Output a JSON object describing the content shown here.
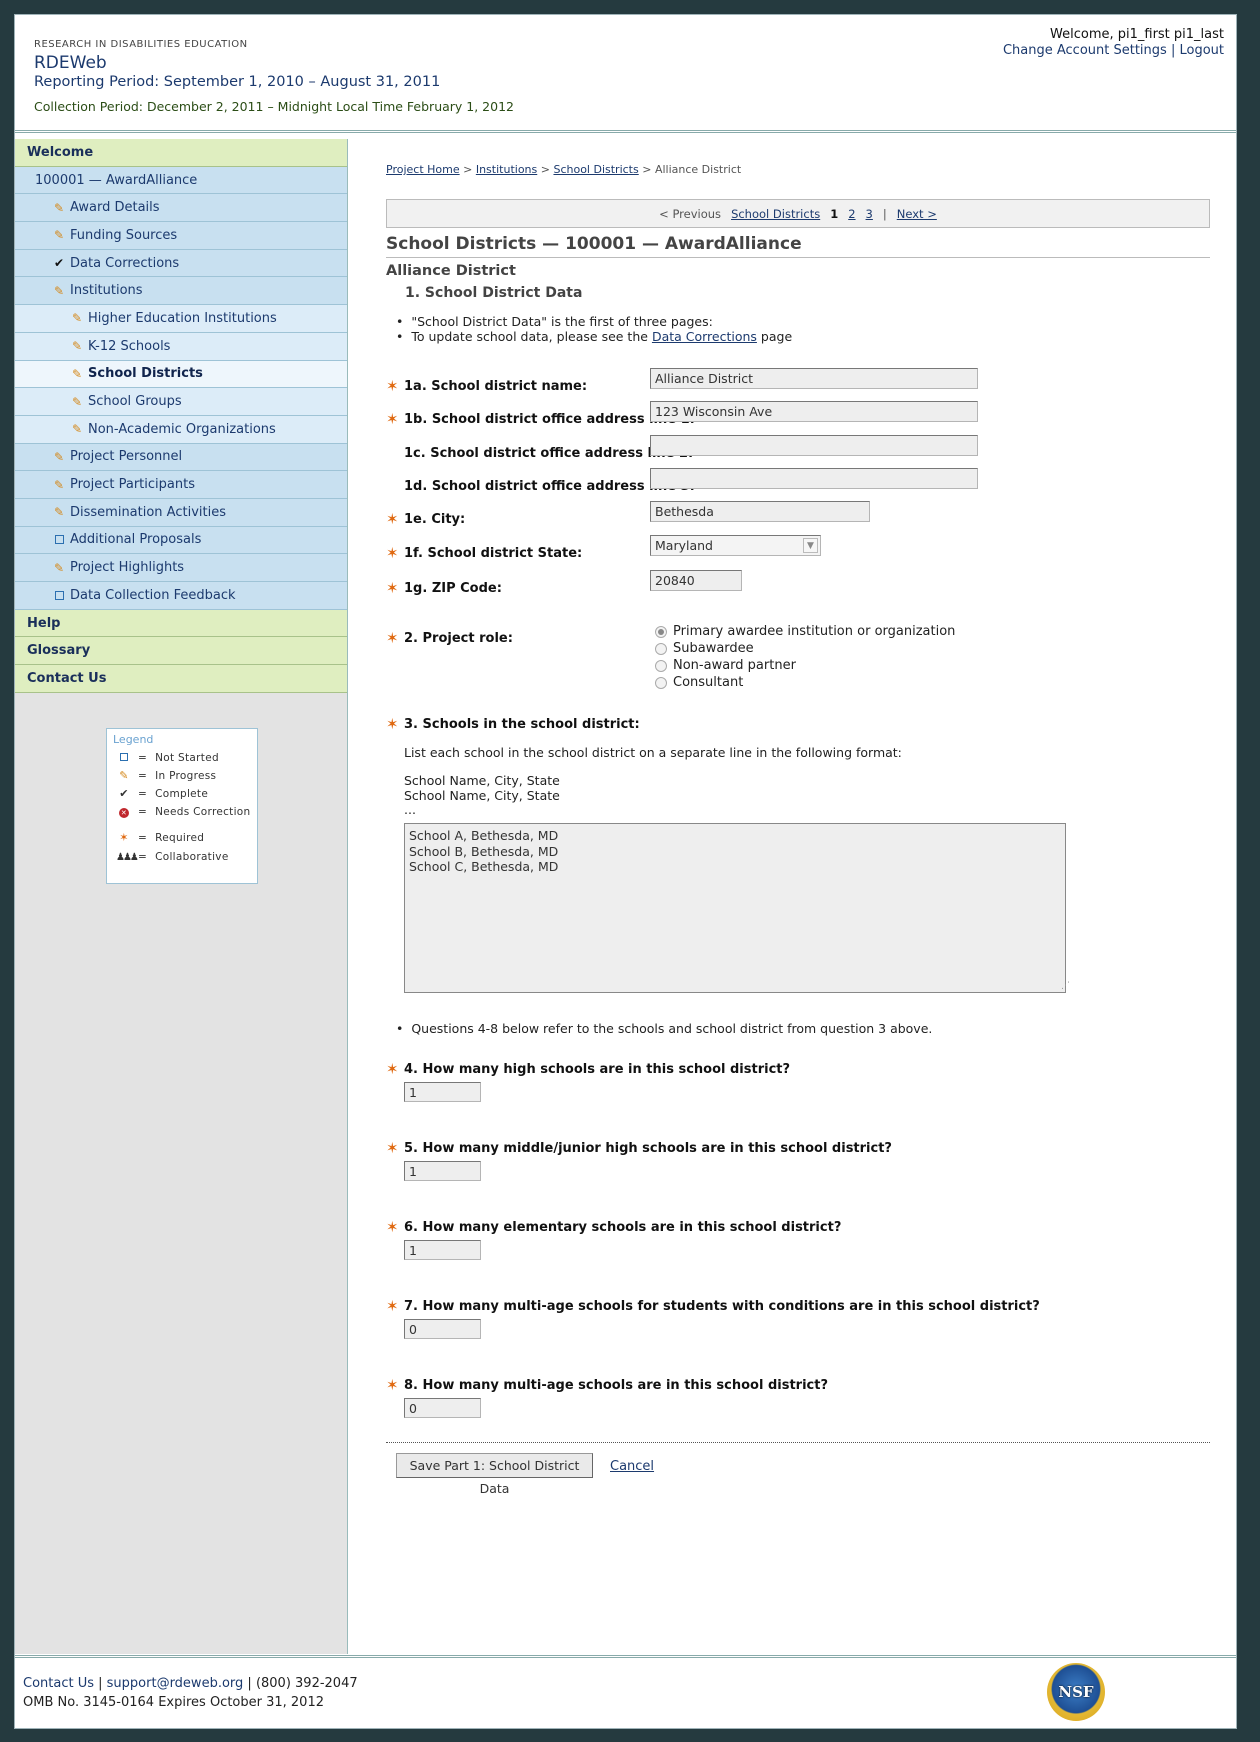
{
  "header": {
    "org": "RESEARCH IN DISABILITIES EDUCATION",
    "app": "RDEWeb",
    "reporting_period": "Reporting Period: September 1, 2010 – August 31, 2011",
    "collection_period": "Collection Period: December 2, 2011 – Midnight Local Time February 1, 2012",
    "welcome": "Welcome, pi1_first pi1_last",
    "change_settings": "Change Account Settings",
    "separator": "|",
    "logout": "Logout"
  },
  "sidebar": {
    "welcome": "Welcome",
    "award": "100001 — AwardAlliance",
    "items": [
      {
        "label": "Award Details",
        "icon": "pencil-icon"
      },
      {
        "label": "Funding Sources",
        "icon": "pencil-icon"
      },
      {
        "label": "Data Corrections",
        "icon": "check-icon"
      },
      {
        "label": "Institutions",
        "icon": "pencil-icon"
      }
    ],
    "sub_items": [
      {
        "label": "Higher Education Institutions",
        "icon": "pencil-icon"
      },
      {
        "label": "K-12 Schools",
        "icon": "pencil-icon"
      },
      {
        "label": "School Districts",
        "icon": "pencil-icon",
        "active": true
      },
      {
        "label": "School Groups",
        "icon": "pencil-icon"
      },
      {
        "label": "Non-Academic Organizations",
        "icon": "pencil-icon"
      }
    ],
    "items2": [
      {
        "label": "Project Personnel",
        "icon": "pencil-icon"
      },
      {
        "label": "Project Participants",
        "icon": "pencil-icon"
      },
      {
        "label": "Dissemination Activities",
        "icon": "pencil-icon"
      },
      {
        "label": "Additional Proposals",
        "icon": "box-icon"
      },
      {
        "label": "Project Highlights",
        "icon": "pencil-icon"
      },
      {
        "label": "Data Collection Feedback",
        "icon": "box-icon"
      }
    ],
    "help": "Help",
    "glossary": "Glossary",
    "contact": "Contact Us"
  },
  "legend": {
    "title": "Legend",
    "eq": "=",
    "not_started": "Not Started",
    "in_progress": "In Progress",
    "complete": "Complete",
    "needs_correction": "Needs Correction",
    "required": "Required",
    "collaborative": "Collaborative"
  },
  "breadcrumb": {
    "home": "Project Home",
    "institutions": "Institutions",
    "districts": "School Districts",
    "current": "Alliance District",
    "sep": ">"
  },
  "pager": {
    "previous": "< Previous",
    "section": "School Districts",
    "p1": "1",
    "p2": "2",
    "p3": "3",
    "bar": "|",
    "next": "Next >"
  },
  "page": {
    "title": "School Districts — 100001 — AwardAlliance",
    "district": "Alliance District",
    "section": "1. School District Data",
    "note1": "\"School District Data\" is the first of three pages:",
    "note2_pre": "To update school data, please see the",
    "note2_link": "Data Corrections",
    "note2_post": "page"
  },
  "form": {
    "q1a": {
      "label": "1a. School district name:",
      "value": "Alliance District"
    },
    "q1b": {
      "label": "1b. School district office address line 1:",
      "value": "123 Wisconsin Ave"
    },
    "q1c": {
      "label": "1c. School district office address line 2:",
      "value": ""
    },
    "q1d": {
      "label": "1d. School district office address line 3:",
      "value": ""
    },
    "q1e": {
      "label": "1e. City:",
      "value": "Bethesda"
    },
    "q1f": {
      "label": "1f. School district State:",
      "value": "Maryland"
    },
    "q1g": {
      "label": "1g. ZIP Code:",
      "value": "20840"
    },
    "q2": {
      "label": "2. Project role:",
      "options": [
        "Primary awardee institution or organization",
        "Subawardee",
        "Non-award partner",
        "Consultant"
      ],
      "selected": "Primary awardee institution or organization"
    },
    "q3": {
      "label": "3. Schools in the school district:",
      "instruction": "List each school in the school district on a separate line in the following format:",
      "format1": "School Name, City, State",
      "format2": "School Name, City, State",
      "format3": "...",
      "value": "School A, Bethesda, MD\nSchool B, Bethesda, MD\nSchool C, Bethesda, MD"
    },
    "note_q4_8": "Questions 4-8 below refer to the schools and school district from question 3 above.",
    "q4": {
      "label": "4. How many high schools are in this school district?",
      "value": "1"
    },
    "q5": {
      "label": "5. How many middle/junior high schools are in this school district?",
      "value": "1"
    },
    "q6": {
      "label": "6. How many elementary schools are in this school district?",
      "value": "1"
    },
    "q7": {
      "label": "7. How many multi-age schools for students with conditions are in this school district?",
      "value": "0"
    },
    "q8": {
      "label": "8. How many multi-age schools are in this school district?",
      "value": "0"
    },
    "save": "Save Part 1: School District Data",
    "cancel": "Cancel"
  },
  "footer": {
    "contact": "Contact Us",
    "sep1": " | ",
    "email": "support@rdeweb.org",
    "sep2": " | ",
    "phone": "(800) 392-2047",
    "omb": "OMB No. 3145-0164 Expires October 31, 2012",
    "logo_text": "NSF"
  },
  "colors": {
    "background": "#253a3f",
    "nav_green": "#dfeec0",
    "nav_blue": "#c8e0f0",
    "link": "#1c3a6e",
    "required_star": "#e06a12"
  }
}
